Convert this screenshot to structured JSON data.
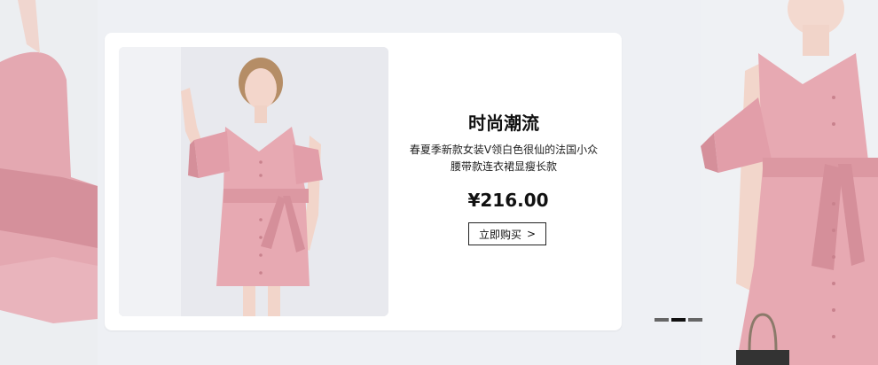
{
  "product": {
    "title": "时尚潮流",
    "desc_line1": "春夏季新款女装V领白色很仙的法国小众",
    "desc_line2": "腰带款连衣裙显瘦长款",
    "price": "¥216.00",
    "buy_label": "立即购买",
    "buy_arrow": ">"
  },
  "carousel": {
    "dot_count": 3,
    "active_index": 1
  },
  "colors": {
    "dress": "#e7a9b2",
    "dress_shadow": "#d58f9a",
    "card_bg": "#ffffff",
    "page_bg": "#eef0f4"
  }
}
